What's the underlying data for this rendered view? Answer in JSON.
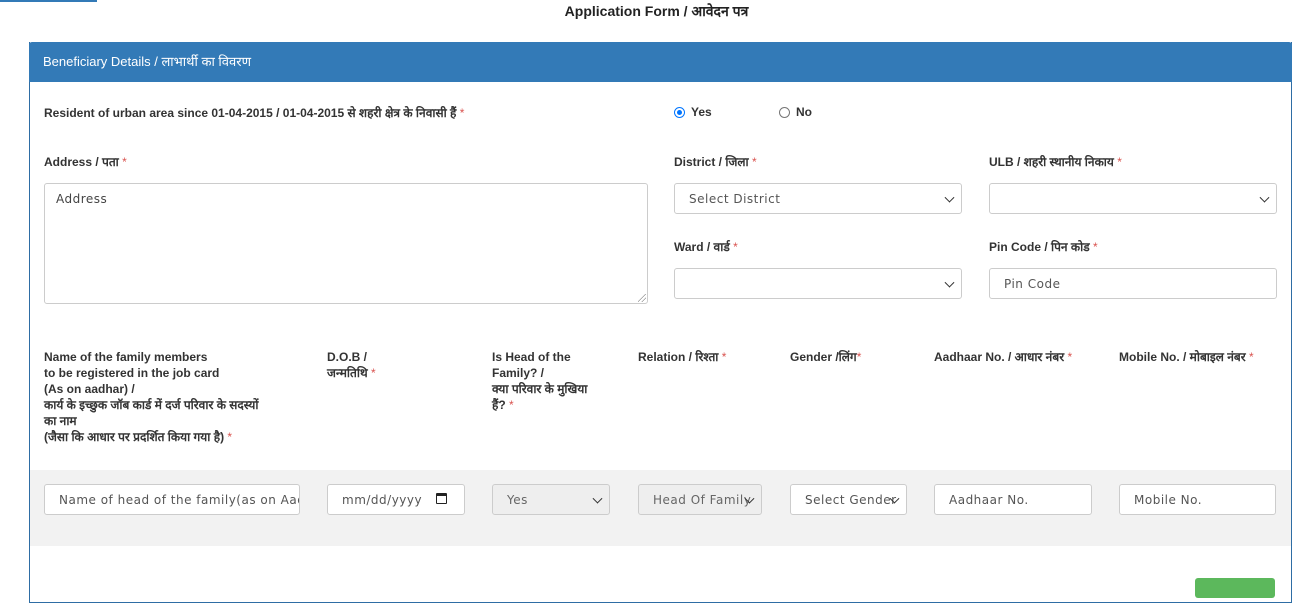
{
  "page": {
    "title": "Application Form / आवेदन पत्र"
  },
  "panel": {
    "heading": "Beneficiary Details / लाभार्थी का विवरण"
  },
  "resident": {
    "label": "Resident of urban area since 01-04-2015 / 01-04-2015 से शहरी क्षेत्र के निवासी हैं",
    "required_mark": "*",
    "options": [
      "Yes",
      "No"
    ],
    "selected": "Yes"
  },
  "address": {
    "label": "Address / पता",
    "placeholder": "Address"
  },
  "district": {
    "label": "District / जिला",
    "selected": "Select District"
  },
  "ulb": {
    "label": "ULB / शहरी स्थानीय निकाय",
    "selected": ""
  },
  "ward": {
    "label": "Ward / वार्ड",
    "selected": ""
  },
  "pincode": {
    "label": "Pin Code / पिन कोड",
    "placeholder": "Pin Code"
  },
  "family_table": {
    "headers": {
      "name": [
        "Name of the family members",
        "to be registered in the job card",
        "(As on aadhar) /",
        "कार्य के इच्छुक जॉब कार्ड में दर्ज परिवार के सदस्यों",
        "का नाम",
        "(जैसा कि आधार पर प्रदर्शित किया गया है)"
      ],
      "dob": [
        "D.O.B /",
        "जन्मतिथि"
      ],
      "head": [
        "Is Head of the",
        "Family? /",
        "क्या परिवार के मुखिया",
        "हैं?"
      ],
      "relation": "Relation / रिश्ता",
      "gender": "Gender /लिंग",
      "aadhaar": "Aadhaar No. / आधार नंबर",
      "mobile": "Mobile No. / मोबाइल नंबर"
    },
    "row": {
      "name_placeholder": "Name of head of the family(as on Aadhaar)",
      "dob_placeholder": "mm/dd/yyyy",
      "is_head": "Yes",
      "relation": "Head Of Family",
      "gender": "Select Gender",
      "aadhaar_placeholder": "Aadhaar No.",
      "mobile_placeholder": "Mobile No."
    }
  }
}
